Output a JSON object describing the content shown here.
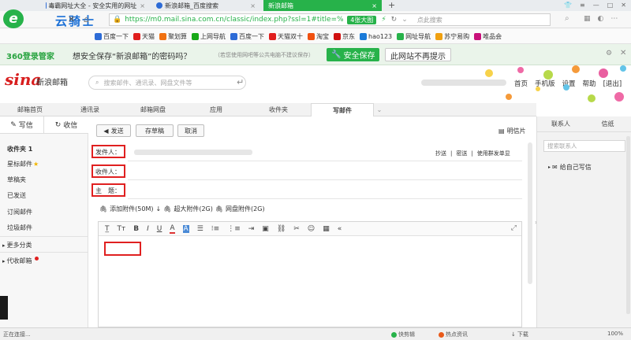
{
  "browser": {
    "tabs": [
      {
        "label": "毒霸网址大全 - 安全实用的网址",
        "close": "×"
      },
      {
        "label": "新浪邮箱_百度搜索",
        "close": "×"
      },
      {
        "label": "新浪邮箱",
        "close": "×"
      }
    ],
    "new_tab": "+",
    "url": "https://m0.mail.sina.com.cn/classic/index.php?ssl=1#title=%",
    "badge": "4张大图",
    "search_placeholder": "点此搜索",
    "watermark": "云骑士"
  },
  "bookmarks": [
    {
      "label": "百度一下",
      "color": "#2d6bd6"
    },
    {
      "label": "天猫",
      "color": "#e01e1e"
    },
    {
      "label": "聚划算",
      "color": "#f07010"
    },
    {
      "label": "上网导航",
      "color": "#18a818"
    },
    {
      "label": "百度一下",
      "color": "#2d6bd6"
    },
    {
      "label": "天猫双十",
      "color": "#e01e1e"
    },
    {
      "label": "淘宝",
      "color": "#f05010"
    },
    {
      "label": "京东",
      "color": "#d01010"
    },
    {
      "label": "hao123",
      "color": "#1a7ad8"
    },
    {
      "label": "网址导航",
      "color": "#27b24a"
    },
    {
      "label": "苏宁易购",
      "color": "#f0a010"
    },
    {
      "label": "唯品会",
      "color": "#c8107a"
    }
  ],
  "save_prompt": {
    "logo": "360登录管家",
    "message": "想安全保存“新浪邮箱”的密码吗？",
    "note": "（若您使用网吧等公共电脑不建议保存）",
    "save_btn": "安全保存",
    "never_btn": "此网站不再提示"
  },
  "header": {
    "logo": "sina",
    "logo_sub": "新浪邮箱",
    "search_placeholder": "搜索邮件、通讯录、网盘文件等",
    "links": [
      "首页",
      "手机版",
      "设置",
      "帮助",
      "[退出]"
    ]
  },
  "nav_tabs": [
    "邮箱首页",
    "通讯录",
    "邮箱网盘",
    "应用",
    "收件夹",
    "写邮件"
  ],
  "sidebar": {
    "write": "写信",
    "receive": "收信",
    "items": [
      "收件夹 1",
      "星标邮件",
      "草稿夹",
      "已发送",
      "订阅邮件",
      "垃圾邮件"
    ],
    "more": "更多分类",
    "proxy": "代收邮箱"
  },
  "compose": {
    "send": "发送",
    "save_draft": "存草稿",
    "cancel": "取消",
    "postcard": "明信片",
    "from_label": "发件人：",
    "to_label": "收件人：",
    "subject_label": "主　题：",
    "cc": "抄送",
    "bcc": "密送",
    "group": "使用群发单显",
    "attach": "添加附件(50M)",
    "big_attach": "超大附件(2G)",
    "disk_attach": "网盘附件(2G)"
  },
  "right_panel": {
    "tab_contacts": "联系人",
    "tab_letter": "信纸",
    "search_placeholder": "搜索联系人",
    "self": "给自己写信"
  },
  "status": {
    "left": "正在连接...",
    "items": [
      "快剪辑",
      "热点资讯",
      "下载"
    ],
    "zoom": "100%"
  }
}
